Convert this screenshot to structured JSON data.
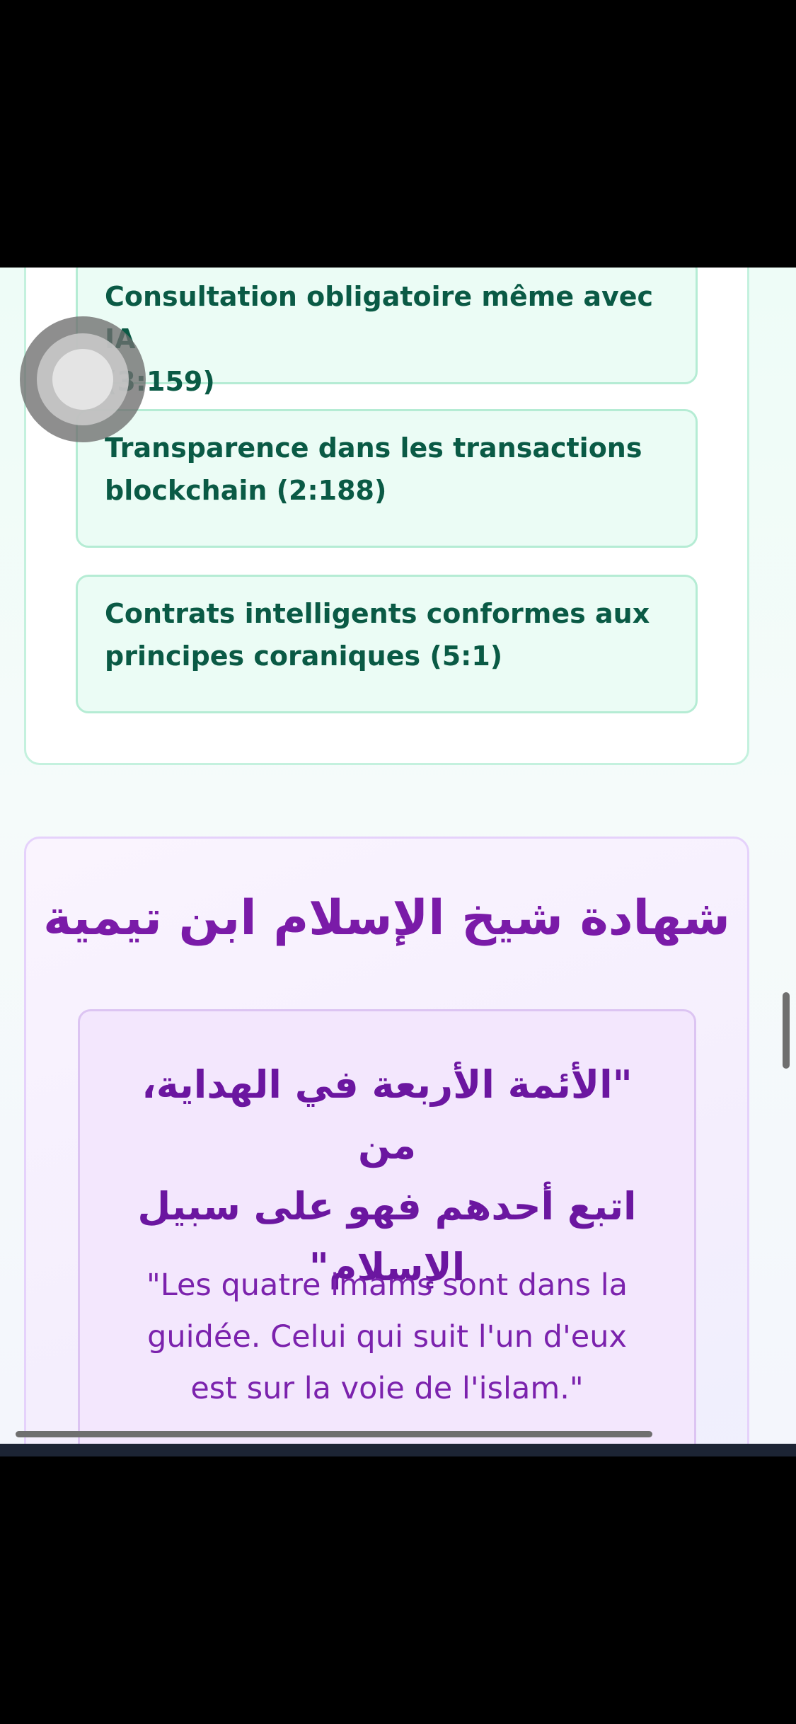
{
  "rules": {
    "items": [
      {
        "line1": "Consultation obligatoire même avec IA",
        "line2": "(3:159)"
      },
      {
        "line1": "Transparence dans les transactions",
        "line2": "blockchain (2:188)"
      },
      {
        "line1": "Contrats intelligents conformes aux",
        "line2": "principes coraniques (5:1)"
      }
    ]
  },
  "testimony": {
    "title": "شهادة شيخ الإسلام ابن تيمية",
    "arabic_lines": [
      "\"الأئمة الأربعة في الهداية، من",
      "اتبع أحدهم فهو على سبيل",
      "الإسلام\""
    ],
    "french_lines": [
      "\"Les quatre imams sont dans la",
      "guidée. Celui qui suit l'un d'eux",
      "est sur la voie de l'islam.\""
    ]
  },
  "colors": {
    "rule_text": "#0a5a45",
    "rule_card_bg": "#ebfcf5",
    "title_purple": "#7a1ba8",
    "quote_card_bg": "#f3e7fd"
  }
}
